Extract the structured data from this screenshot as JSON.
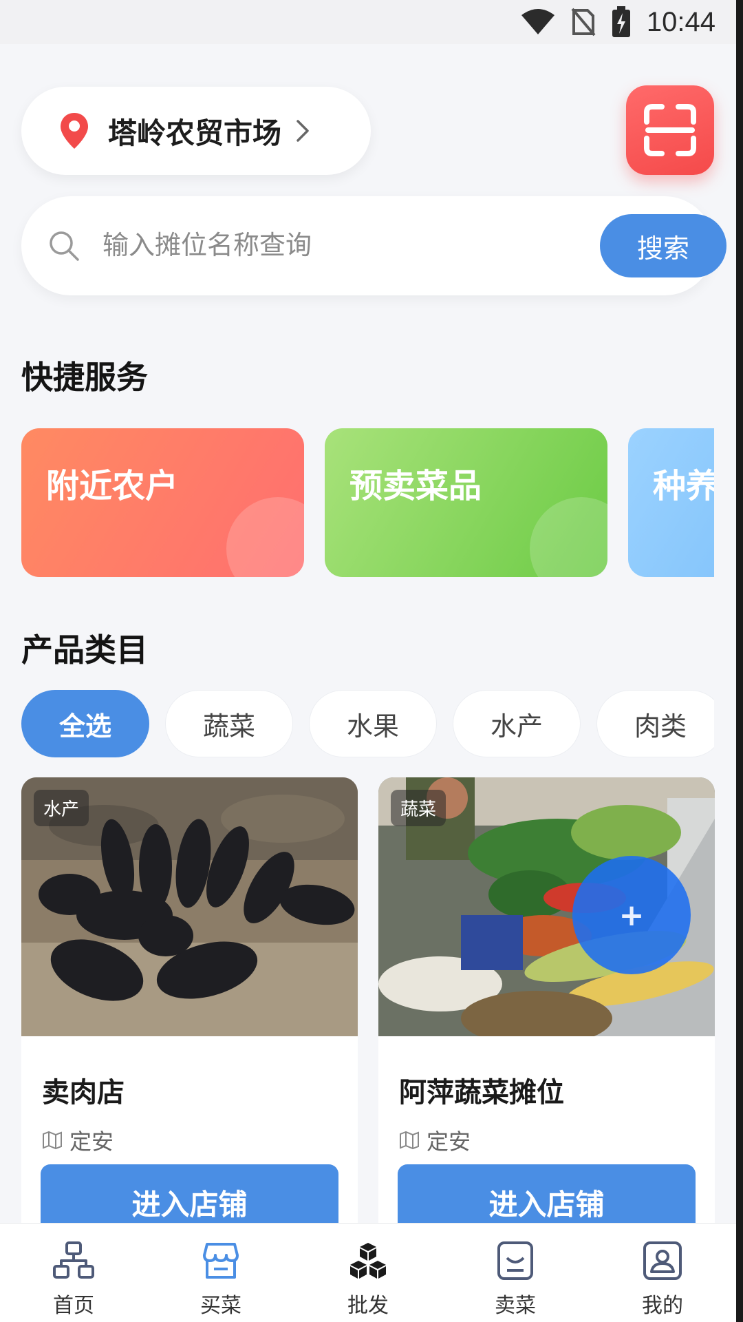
{
  "status_bar": {
    "time": "10:44"
  },
  "location": {
    "name": "塔岭农贸市场"
  },
  "search": {
    "placeholder": "输入摊位名称查询",
    "button_label": "搜索"
  },
  "quick_services": {
    "title": "快捷服务",
    "items": [
      {
        "label": "附近农户",
        "color": "#ff7a6a"
      },
      {
        "label": "预卖菜品",
        "color": "#8ed65b"
      },
      {
        "label": "种养",
        "color": "#8cc6fb"
      }
    ]
  },
  "categories": {
    "title": "产品类目",
    "items": [
      {
        "label": "全选",
        "active": true
      },
      {
        "label": "蔬菜",
        "active": false
      },
      {
        "label": "水果",
        "active": false
      },
      {
        "label": "水产",
        "active": false
      },
      {
        "label": "肉类",
        "active": false
      }
    ]
  },
  "products": [
    {
      "tag": "水产",
      "name": "卖肉店",
      "location": "定安",
      "button_label": "进入店铺"
    },
    {
      "tag": "蔬菜",
      "name": "阿萍蔬菜摊位",
      "location": "定安",
      "button_label": "进入店铺"
    }
  ],
  "fab": {
    "label": "+"
  },
  "bottom_nav": {
    "items": [
      {
        "label": "首页"
      },
      {
        "label": "买菜"
      },
      {
        "label": "批发"
      },
      {
        "label": "卖菜"
      },
      {
        "label": "我的"
      }
    ],
    "active_color": "#4a8ee4"
  }
}
